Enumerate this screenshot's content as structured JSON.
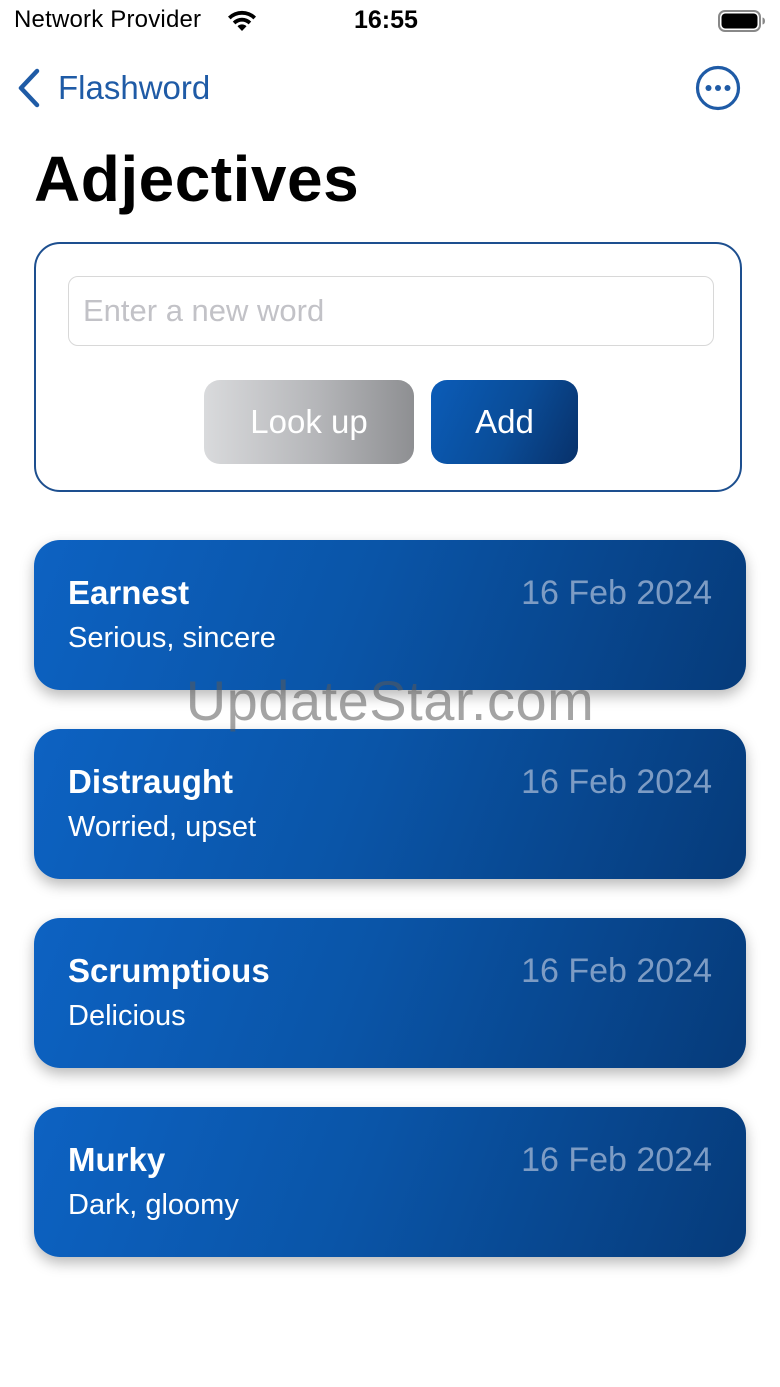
{
  "status_bar": {
    "carrier": "Network Provider",
    "time": "16:55",
    "wifi_icon": "wifi-icon",
    "battery_icon": "battery-icon"
  },
  "nav": {
    "back_label": "Flashword",
    "back_icon": "chevron-left-icon",
    "more_icon": "ellipsis-circle-icon"
  },
  "page": {
    "title": "Adjectives"
  },
  "entry": {
    "input_value": "",
    "input_placeholder": "Enter a new word",
    "lookup_label": "Look up",
    "add_label": "Add"
  },
  "words": [
    {
      "word": "Earnest",
      "meaning": "Serious, sincere",
      "date": "16 Feb 2024"
    },
    {
      "word": "Distraught",
      "meaning": "Worried, upset",
      "date": "16 Feb 2024"
    },
    {
      "word": "Scrumptious",
      "meaning": "Delicious",
      "date": "16 Feb 2024"
    },
    {
      "word": "Murky",
      "meaning": "Dark, gloomy",
      "date": "16 Feb 2024"
    }
  ],
  "watermark": "UpdateStar.com",
  "colors": {
    "accent": "#1f5ba6",
    "card_gradient_start": "#0d62c2",
    "card_gradient_end": "#063b7a",
    "date_text": "#7d9cc4",
    "entry_border": "#1d4f8f"
  }
}
